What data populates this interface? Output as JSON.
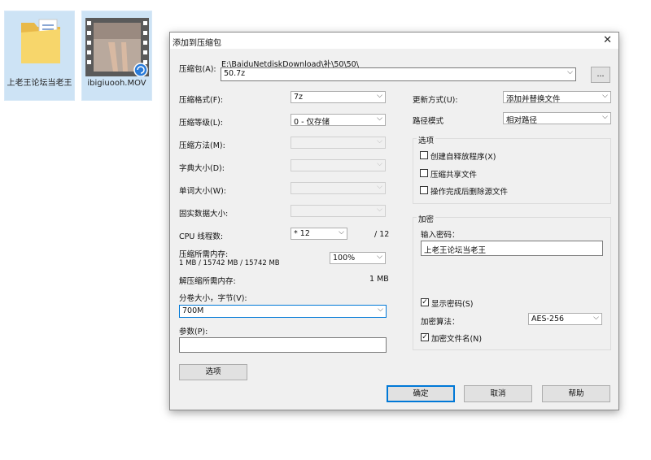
{
  "desktop": {
    "icons": [
      {
        "label": "上老王论坛当老王",
        "icon": "folder-icon"
      },
      {
        "label": "ibigiuooh.MOV",
        "icon": "video-file-icon"
      }
    ]
  },
  "dialog": {
    "title": "添加到压缩包",
    "close_icon": "✕",
    "archive": {
      "label": "压缩包(A):",
      "path": "E:\\BaiduNetdiskDownload\\补\\50\\50\\",
      "value": "50.7z",
      "browse": "..."
    },
    "left": {
      "format": {
        "label": "压缩格式(F):",
        "value": "7z"
      },
      "level": {
        "label": "压缩等级(L):",
        "value": "0 - 仅存储"
      },
      "method": {
        "label": "压缩方法(M):",
        "value": ""
      },
      "dict": {
        "label": "字典大小(D):",
        "value": ""
      },
      "word": {
        "label": "单词大小(W):",
        "value": ""
      },
      "solid": {
        "label": "固实数据大小:",
        "value": ""
      },
      "cpu": {
        "label": "CPU 线程数:",
        "value": "* 12",
        "max": "/ 12"
      },
      "mem_compress": {
        "label": "压缩所需内存:",
        "detail": "1 MB / 15742 MB / 15742 MB",
        "value": "100%"
      },
      "mem_decompress": {
        "label": "解压缩所需内存:",
        "value": "1 MB"
      },
      "split": {
        "label": "分卷大小，字节(V):",
        "value": "700M"
      },
      "params": {
        "label": "参数(P):",
        "value": ""
      },
      "options_button": "选项"
    },
    "right": {
      "update": {
        "label": "更新方式(U):",
        "value": "添加并替换文件"
      },
      "path_mode": {
        "label": "路径模式",
        "value": "相对路径"
      },
      "options_group": {
        "title": "选项",
        "sfx": {
          "label": "创建自释放程序(X)",
          "checked": false
        },
        "shared": {
          "label": "压缩共享文件",
          "checked": false
        },
        "delete": {
          "label": "操作完成后删除源文件",
          "checked": false
        }
      },
      "encrypt_group": {
        "title": "加密",
        "password_label": "输入密码：",
        "password_value": "上老王论坛当老王",
        "show_password": {
          "label": "显示密码(S)",
          "checked": true
        },
        "algorithm": {
          "label": "加密算法：",
          "value": "AES-256"
        },
        "encrypt_names": {
          "label": "加密文件名(N)",
          "checked": true
        }
      }
    },
    "buttons": {
      "ok": "确定",
      "cancel": "取消",
      "help": "帮助"
    }
  }
}
